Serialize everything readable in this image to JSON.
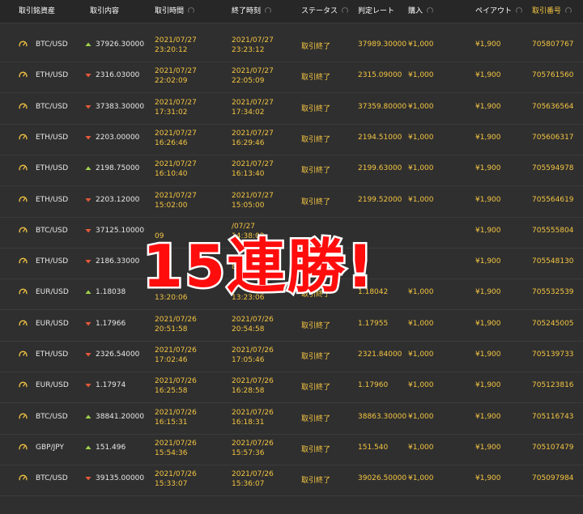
{
  "headers": [
    {
      "label": "取引銘資産",
      "sort": false,
      "active": false
    },
    {
      "label": "取引内容",
      "sort": false,
      "active": false
    },
    {
      "label": "取引時間",
      "sort": true,
      "active": false
    },
    {
      "label": "終了時刻",
      "sort": true,
      "active": false
    },
    {
      "label": "ステータス",
      "sort": true,
      "active": false
    },
    {
      "label": "判定レート",
      "sort": false,
      "active": false
    },
    {
      "label": "購入",
      "sort": true,
      "active": false
    },
    {
      "label": "ペイアウト",
      "sort": true,
      "active": false
    },
    {
      "label": "取引番号",
      "sort": true,
      "active": true
    }
  ],
  "rows": [
    {
      "asset": "BTC/USD",
      "dir": "up",
      "entry": "37926.30000",
      "start_date": "2021/07/27",
      "start_time": "23:20:12",
      "end_date": "2021/07/27",
      "end_time": "23:23:12",
      "status": "取引終了",
      "rate": "37989.30000",
      "purchase": "¥1,000",
      "payout": "¥1,900",
      "id": "705807767"
    },
    {
      "asset": "ETH/USD",
      "dir": "down",
      "entry": "2316.03000",
      "start_date": "2021/07/27",
      "start_time": "22:02:09",
      "end_date": "2021/07/27",
      "end_time": "22:05:09",
      "status": "取引終了",
      "rate": "2315.09000",
      "purchase": "¥1,000",
      "payout": "¥1,900",
      "id": "705761560"
    },
    {
      "asset": "BTC/USD",
      "dir": "down",
      "entry": "37383.30000",
      "start_date": "2021/07/27",
      "start_time": "17:31:02",
      "end_date": "2021/07/27",
      "end_time": "17:34:02",
      "status": "取引終了",
      "rate": "37359.80000",
      "purchase": "¥1,000",
      "payout": "¥1,900",
      "id": "705636564"
    },
    {
      "asset": "ETH/USD",
      "dir": "down",
      "entry": "2203.00000",
      "start_date": "2021/07/27",
      "start_time": "16:26:46",
      "end_date": "2021/07/27",
      "end_time": "16:29:46",
      "status": "取引終了",
      "rate": "2194.51000",
      "purchase": "¥1,000",
      "payout": "¥1,900",
      "id": "705606317"
    },
    {
      "asset": "ETH/USD",
      "dir": "up",
      "entry": "2198.75000",
      "start_date": "2021/07/27",
      "start_time": "16:10:40",
      "end_date": "2021/07/27",
      "end_time": "16:13:40",
      "status": "取引終了",
      "rate": "2199.63000",
      "purchase": "¥1,000",
      "payout": "¥1,900",
      "id": "705594978"
    },
    {
      "asset": "ETH/USD",
      "dir": "down",
      "entry": "2203.12000",
      "start_date": "2021/07/27",
      "start_time": "15:02:00",
      "end_date": "2021/07/27",
      "end_time": "15:05:00",
      "status": "取引終了",
      "rate": "2199.52000",
      "purchase": "¥1,000",
      "payout": "¥1,900",
      "id": "705564619"
    },
    {
      "asset": "BTC/USD",
      "dir": "down",
      "entry": "37125.10000",
      "start_date": "",
      "start_time": "09",
      "end_date": "/07/27",
      "end_time": "14:38:09",
      "status": "",
      "rate": "",
      "purchase": "",
      "payout": "¥1,900",
      "id": "705555804"
    },
    {
      "asset": "ETH/USD",
      "dir": "down",
      "entry": "2186.33000",
      "start_date": "",
      "start_time": "",
      "end_date": "",
      "end_time": "8:38",
      "status": "",
      "rate": "",
      "purchase": "",
      "payout": "¥1,900",
      "id": "705548130"
    },
    {
      "asset": "EUR/USD",
      "dir": "up",
      "entry": "1.18038",
      "start_date": "",
      "start_time": "13:20:06",
      "end_date": "",
      "end_time": "13:23:06",
      "status": "取引終了",
      "rate": "1.18042",
      "purchase": "¥1,000",
      "payout": "¥1,900",
      "id": "705532539"
    },
    {
      "asset": "EUR/USD",
      "dir": "down",
      "entry": "1.17966",
      "start_date": "2021/07/26",
      "start_time": "20:51:58",
      "end_date": "2021/07/26",
      "end_time": "20:54:58",
      "status": "取引終了",
      "rate": "1.17955",
      "purchase": "¥1,000",
      "payout": "¥1,900",
      "id": "705245005"
    },
    {
      "asset": "ETH/USD",
      "dir": "down",
      "entry": "2326.54000",
      "start_date": "2021/07/26",
      "start_time": "17:02:46",
      "end_date": "2021/07/26",
      "end_time": "17:05:46",
      "status": "取引終了",
      "rate": "2321.84000",
      "purchase": "¥1,000",
      "payout": "¥1,900",
      "id": "705139733"
    },
    {
      "asset": "EUR/USD",
      "dir": "down",
      "entry": "1.17974",
      "start_date": "2021/07/26",
      "start_time": "16:25:58",
      "end_date": "2021/07/26",
      "end_time": "16:28:58",
      "status": "取引終了",
      "rate": "1.17960",
      "purchase": "¥1,000",
      "payout": "¥1,900",
      "id": "705123816"
    },
    {
      "asset": "BTC/USD",
      "dir": "up",
      "entry": "38841.20000",
      "start_date": "2021/07/26",
      "start_time": "16:15:31",
      "end_date": "2021/07/26",
      "end_time": "16:18:31",
      "status": "取引終了",
      "rate": "38863.30000",
      "purchase": "¥1,000",
      "payout": "¥1,900",
      "id": "705116743"
    },
    {
      "asset": "GBP/JPY",
      "dir": "up",
      "entry": "151.496",
      "start_date": "2021/07/26",
      "start_time": "15:54:36",
      "end_date": "2021/07/26",
      "end_time": "15:57:36",
      "status": "取引終了",
      "rate": "151.540",
      "purchase": "¥1,000",
      "payout": "¥1,900",
      "id": "705107479"
    },
    {
      "asset": "BTC/USD",
      "dir": "down",
      "entry": "39135.00000",
      "start_date": "2021/07/26",
      "start_time": "15:33:07",
      "end_date": "2021/07/26",
      "end_time": "15:36:07",
      "status": "取引終了",
      "rate": "39026.50000",
      "purchase": "¥1,000",
      "payout": "¥1,900",
      "id": "705097984"
    }
  ],
  "banner": "15連勝!",
  "colors": {
    "gold": "#f4c542",
    "up": "#9ed34a",
    "down": "#e8593a",
    "banner": "#ff0d0d"
  }
}
